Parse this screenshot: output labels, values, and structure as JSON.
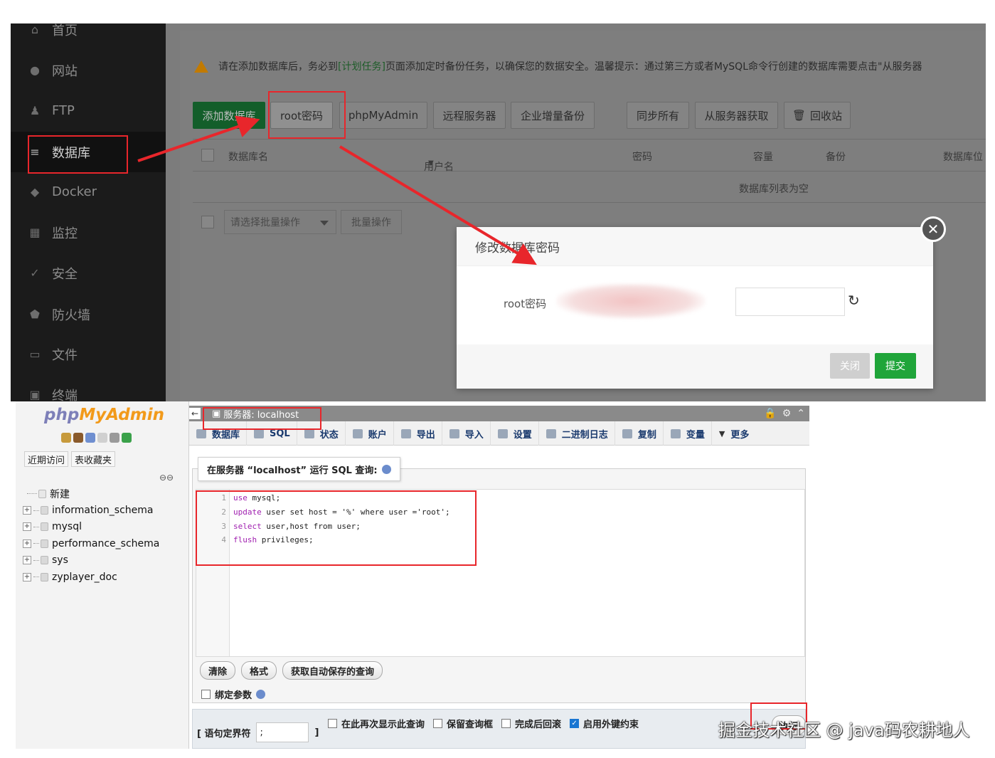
{
  "bt_panel": {
    "sidebar": [
      {
        "label": "首页",
        "icon": "home-icon"
      },
      {
        "label": "网站",
        "icon": "globe-icon"
      },
      {
        "label": "FTP",
        "icon": "user-icon"
      },
      {
        "label": "数据库",
        "icon": "database-icon"
      },
      {
        "label": "Docker",
        "icon": "docker-icon"
      },
      {
        "label": "监控",
        "icon": "monitor-icon"
      },
      {
        "label": "安全",
        "icon": "shield-check-icon"
      },
      {
        "label": "防火墙",
        "icon": "firewall-icon"
      },
      {
        "label": "文件",
        "icon": "folder-icon"
      },
      {
        "label": "终端",
        "icon": "terminal-icon"
      }
    ],
    "notice": {
      "prefix": "请在添加数据库后，务必到",
      "link": "[计划任务]",
      "suffix": "页面添加定时备份任务，以确保您的数据安全。温馨提示：通过第三方或者MySQL命令行创建的数据库需要点击\"从服务器"
    },
    "toolbar": {
      "add_db": "添加数据库",
      "root_pwd": "root密码",
      "phpmyadmin": "phpMyAdmin",
      "remote_server": "远程服务器",
      "enterprise_backup": "企业增量备份",
      "sync_all": "同步所有",
      "fetch_from_server": "从服务器获取",
      "recycle_bin": "回收站"
    },
    "table": {
      "columns": [
        "数据库名",
        "用户名",
        "密码",
        "容量",
        "备份",
        "数据库位"
      ],
      "empty": "数据库列表为空"
    },
    "batch": {
      "select_placeholder": "请选择批量操作",
      "button": "批量操作"
    },
    "modal": {
      "title": "修改数据库密码",
      "label": "root密码",
      "close": "关闭",
      "submit": "提交",
      "refresh_icon": "refresh-icon",
      "close_icon": "close-icon"
    }
  },
  "pma": {
    "logo_php": "php",
    "logo_myadmin": "MyAdmin",
    "tabs": [
      "近期访问",
      "表收藏夹"
    ],
    "tree": [
      {
        "label": "新建",
        "new": true
      },
      {
        "label": "information_schema"
      },
      {
        "label": "mysql"
      },
      {
        "label": "performance_schema"
      },
      {
        "label": "sys"
      },
      {
        "label": "zyplayer_doc"
      }
    ],
    "server_breadcrumb": "服务器: localhost",
    "menu": [
      "数据库",
      "SQL",
      "状态",
      "账户",
      "导出",
      "导入",
      "设置",
      "二进制日志",
      "复制",
      "变量",
      "更多"
    ],
    "query_legend": "在服务器 “localhost” 运行 SQL 查询:",
    "sql_lines": [
      {
        "num": "1",
        "kw1": "use",
        "rest": " mysql;"
      },
      {
        "num": "2",
        "kw1": "update",
        "rest": " user set host = '%' where user ='root';"
      },
      {
        "num": "3",
        "kw1": "select",
        "rest": " user,host from user;"
      },
      {
        "num": "4",
        "kw1": "flush",
        "rest": " privileges;"
      }
    ],
    "buttons": {
      "clear": "清除",
      "format": "格式",
      "get_autosaved": "获取自动保存的查询"
    },
    "bind_params": "绑定参数",
    "footer": {
      "delimiter_label": "[ 语句定界符",
      "delimiter_value": ";",
      "delimiter_close": "]",
      "opt_show_again": "在此再次显示此查询",
      "opt_keep_box": "保留查询框",
      "opt_rollback": "完成后回滚",
      "opt_fk": "启用外键约束",
      "go": "执行"
    }
  },
  "watermark": "掘金技术社区 @ java码农耕地人",
  "colors": {
    "bt_green": "#20a53a",
    "annotation_red": "#e8262b",
    "pma_orange": "#f29a1a"
  }
}
